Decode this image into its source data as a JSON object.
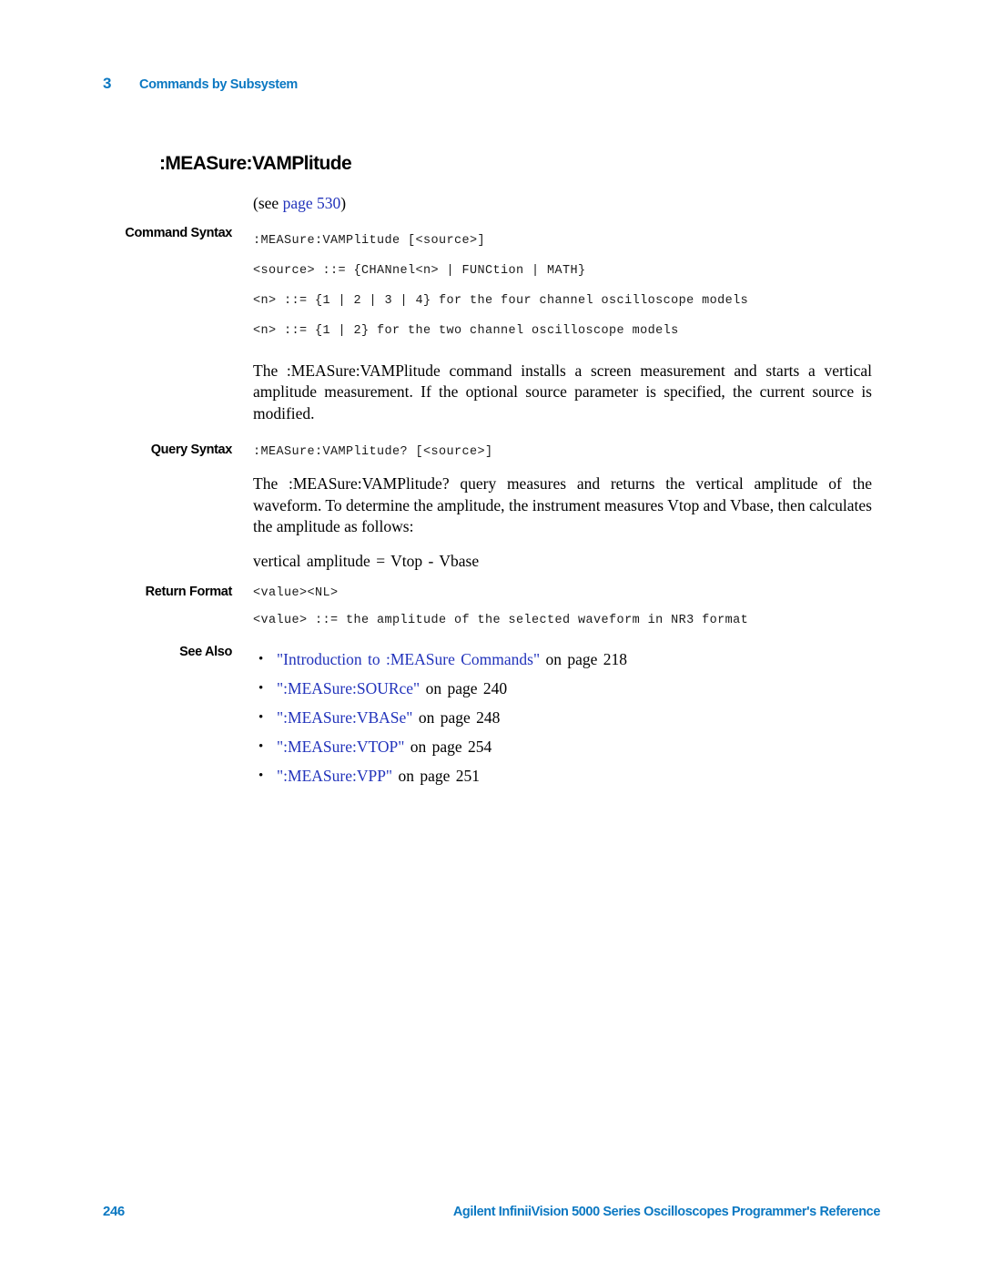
{
  "header": {
    "chapter_number": "3",
    "chapter_title": "Commands by Subsystem"
  },
  "command": {
    "title": ":MEASure:VAMPlitude",
    "see_prefix": "(see ",
    "see_link": "page 530",
    "see_suffix": ")"
  },
  "sections": {
    "command_syntax_label": "Command Syntax",
    "command_syntax_lines": [
      ":MEASure:VAMPlitude [<source>]",
      "<source> ::= {CHANnel<n> | FUNCtion | MATH}",
      "<n> ::= {1 | 2 | 3 | 4} for the four channel oscilloscope models",
      "<n> ::= {1 | 2} for the two channel oscilloscope models"
    ],
    "command_description": "The :MEASure:VAMPlitude command installs a screen measurement and starts a vertical amplitude measurement. If the optional source parameter is specified, the current source is modified.",
    "query_syntax_label": "Query Syntax",
    "query_syntax_line": ":MEASure:VAMPlitude? [<source>]",
    "query_description": "The :MEASure:VAMPlitude? query measures and returns the vertical amplitude of the waveform. To determine the amplitude, the instrument measures Vtop and Vbase, then calculates the amplitude as follows:",
    "formula": "vertical amplitude = Vtop - Vbase",
    "return_format_label": "Return Format",
    "return_format_line": "<value><NL>",
    "return_value_line": "<value> ::= the amplitude of the selected waveform in NR3 format",
    "see_also_label": "See Also",
    "see_also_items": [
      {
        "link": "\"Introduction to :MEASure Commands\"",
        "tail": " on page 218"
      },
      {
        "link": "\":MEASure:SOURce\"",
        "tail": " on page 240"
      },
      {
        "link": "\":MEASure:VBASe\"",
        "tail": " on page 248"
      },
      {
        "link": "\":MEASure:VTOP\"",
        "tail": " on page 254"
      },
      {
        "link": "\":MEASure:VPP\"",
        "tail": " on page 251"
      }
    ]
  },
  "footer": {
    "page_number": "246",
    "document_title": "Agilent InfiniiVision 5000 Series Oscilloscopes Programmer's Reference"
  },
  "colors": {
    "agilent_blue": "#0B78C2",
    "link_blue": "#2233BB"
  }
}
